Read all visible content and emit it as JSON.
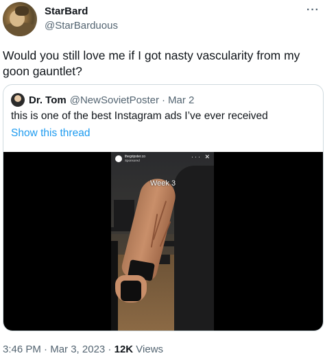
{
  "author": {
    "display_name": "StarBard",
    "handle": "@StarBarduous"
  },
  "more_icon": "more-horizontal-icon",
  "tweet": {
    "text": "Would you still love me if I got nasty vascularity from my goon gauntlet?"
  },
  "quote": {
    "display_name": "Dr. Tom",
    "handle": "@NewSovietPoster",
    "separator": "·",
    "date": "Mar 2",
    "text": "this is one of the best Instagram ads I’ve ever received",
    "show_thread": "Show this thread",
    "video": {
      "account": "thegripster.co",
      "sponsored": "Sponsored",
      "controls": "··· ✕",
      "overlay_text": "Week 3"
    }
  },
  "footer": {
    "time": "3:46 PM",
    "sep1": " · ",
    "date": "Mar 3, 2023",
    "sep2": " · ",
    "views_count": "12K",
    "views_label": " Views"
  }
}
